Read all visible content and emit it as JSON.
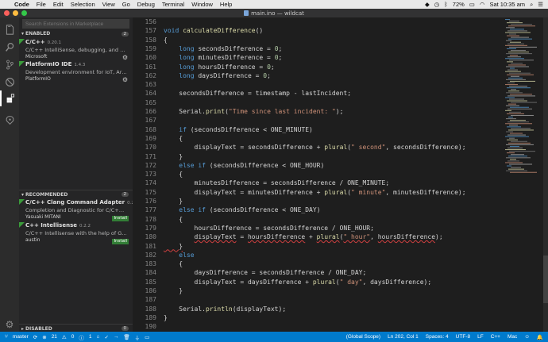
{
  "menubar": {
    "items": [
      "Code",
      "File",
      "Edit",
      "Selection",
      "View",
      "Go",
      "Debug",
      "Terminal",
      "Window",
      "Help"
    ],
    "battery": "72%",
    "clock": "Sat 10:35 am"
  },
  "window": {
    "title": "main.ino — wildcat"
  },
  "sidebar": {
    "search_placeholder": "Search Extensions in Marketplace",
    "enabled": {
      "title": "ENABLED",
      "count": "2",
      "items": [
        {
          "name": "C/C++",
          "version": "0.20.1",
          "description": "C/C++ IntelliSense, debugging, and code ...",
          "publisher": "Microsoft"
        },
        {
          "name": "PlatformIO IDE",
          "version": "1.4.3",
          "description": "Development environment for IoT, Arduino...",
          "publisher": "PlatformIO"
        }
      ]
    },
    "recommended": {
      "title": "RECOMMENDED",
      "count": "2",
      "items": [
        {
          "name": "C/C++ Clang Command Adapter",
          "version": "0.2.3",
          "description": "Completion and Diagnostic for C/C++/Obj...",
          "publisher": "Yasuaki MITANI",
          "action": "Install"
        },
        {
          "name": "C++ Intellisense",
          "version": "0.2.2",
          "description": "C/C++ Intellisense with the help of GNU Gl...",
          "publisher": "austin",
          "action": "Install"
        }
      ]
    },
    "disabled": {
      "title": "DISABLED",
      "count": "0"
    }
  },
  "editor": {
    "line_numbers": [
      "156",
      "157",
      "158",
      "159",
      "160",
      "161",
      "162",
      "163",
      "164",
      "165",
      "166",
      "167",
      "168",
      "169",
      "170",
      "171",
      "172",
      "173",
      "174",
      "175",
      "176",
      "177",
      "178",
      "179",
      "180",
      "181",
      "182",
      "183",
      "184",
      "185",
      "186",
      "187",
      "188",
      "189",
      "190"
    ],
    "lines": [
      [],
      [
        {
          "t": "void ",
          "c": "kw"
        },
        {
          "t": "calculateDifference",
          "c": "fn"
        },
        {
          "t": "()",
          "c": ""
        }
      ],
      [
        {
          "t": "{",
          "c": ""
        }
      ],
      [
        {
          "t": "    long ",
          "c": "kw"
        },
        {
          "t": "secondsDifference = ",
          "c": ""
        },
        {
          "t": "0",
          "c": "num"
        },
        {
          "t": ";",
          "c": ""
        }
      ],
      [
        {
          "t": "    long ",
          "c": "kw"
        },
        {
          "t": "minutesDifference = ",
          "c": ""
        },
        {
          "t": "0",
          "c": "num"
        },
        {
          "t": ";",
          "c": ""
        }
      ],
      [
        {
          "t": "    long ",
          "c": "kw"
        },
        {
          "t": "hoursDifference = ",
          "c": ""
        },
        {
          "t": "0",
          "c": "num"
        },
        {
          "t": ";",
          "c": ""
        }
      ],
      [
        {
          "t": "    long ",
          "c": "kw"
        },
        {
          "t": "daysDifference = ",
          "c": ""
        },
        {
          "t": "0",
          "c": "num"
        },
        {
          "t": ";",
          "c": ""
        }
      ],
      [],
      [
        {
          "t": "    secondsDifference = timestamp - lastIncident;",
          "c": ""
        }
      ],
      [],
      [
        {
          "t": "    Serial.",
          "c": ""
        },
        {
          "t": "print",
          "c": "fn"
        },
        {
          "t": "(",
          "c": ""
        },
        {
          "t": "\"Time since last incident: \"",
          "c": "str"
        },
        {
          "t": ");",
          "c": ""
        }
      ],
      [],
      [
        {
          "t": "    if ",
          "c": "kw"
        },
        {
          "t": "(secondsDifference < ONE_MINUTE)",
          "c": ""
        }
      ],
      [
        {
          "t": "    {",
          "c": ""
        }
      ],
      [
        {
          "t": "        displayText = secondsDifference + ",
          "c": ""
        },
        {
          "t": "plural",
          "c": "fn"
        },
        {
          "t": "(",
          "c": ""
        },
        {
          "t": "\" second\"",
          "c": "str"
        },
        {
          "t": ", secondsDifference);",
          "c": ""
        }
      ],
      [
        {
          "t": "    }",
          "c": ""
        }
      ],
      [
        {
          "t": "    else if ",
          "c": "kw"
        },
        {
          "t": "(secondsDifference < ONE_HOUR)",
          "c": ""
        }
      ],
      [
        {
          "t": "    {",
          "c": ""
        }
      ],
      [
        {
          "t": "        minutesDifference = secondsDifference / ONE_MINUTE;",
          "c": ""
        }
      ],
      [
        {
          "t": "        displayText = minutesDifference + ",
          "c": ""
        },
        {
          "t": "plural",
          "c": "fn"
        },
        {
          "t": "(",
          "c": ""
        },
        {
          "t": "\" minute\"",
          "c": "str"
        },
        {
          "t": ", minutesDifference);",
          "c": ""
        }
      ],
      [
        {
          "t": "    }",
          "c": ""
        }
      ],
      [
        {
          "t": "    else if ",
          "c": "kw"
        },
        {
          "t": "(secondsDifference < ONE_DAY)",
          "c": ""
        }
      ],
      [
        {
          "t": "    {",
          "c": ""
        }
      ],
      [
        {
          "t": "        hoursDifference = secondsDifference / ONE_HOUR;",
          "c": ""
        }
      ],
      [
        {
          "t": "        ",
          "c": ""
        },
        {
          "t": "displayText",
          "c": "sq"
        },
        {
          "t": " = ",
          "c": ""
        },
        {
          "t": "hoursDifference",
          "c": "sq"
        },
        {
          "t": " + ",
          "c": ""
        },
        {
          "t": "plural",
          "c": "fn sq"
        },
        {
          "t": "(",
          "c": ""
        },
        {
          "t": "\" hour\"",
          "c": "str sq"
        },
        {
          "t": ", ",
          "c": ""
        },
        {
          "t": "hoursDifference",
          "c": "sq"
        },
        {
          "t": ");",
          "c": ""
        }
      ],
      [
        {
          "t": "    }",
          "c": "sq"
        }
      ],
      [
        {
          "t": "    else",
          "c": "kw"
        }
      ],
      [
        {
          "t": "    {",
          "c": ""
        }
      ],
      [
        {
          "t": "        daysDifference = secondsDifference / ONE_DAY;",
          "c": ""
        }
      ],
      [
        {
          "t": "        displayText = daysDifference + ",
          "c": ""
        },
        {
          "t": "plural",
          "c": "fn"
        },
        {
          "t": "(",
          "c": ""
        },
        {
          "t": "\" day\"",
          "c": "str"
        },
        {
          "t": ", daysDifference);",
          "c": ""
        }
      ],
      [
        {
          "t": "    }",
          "c": ""
        }
      ],
      [],
      [
        {
          "t": "    Serial.",
          "c": ""
        },
        {
          "t": "println",
          "c": "fn"
        },
        {
          "t": "(displayText);",
          "c": ""
        }
      ],
      [
        {
          "t": "}",
          "c": ""
        }
      ],
      []
    ]
  },
  "statusbar": {
    "branch": "master",
    "errors": "21",
    "warnings": "0",
    "alerts": "1",
    "scope": "(Global Scope)",
    "position": "Ln 202, Col 1",
    "spaces": "Spaces: 4",
    "encoding": "UTF-8",
    "eol": "LF",
    "language": "C++",
    "platform": "Mac"
  },
  "colors": {
    "accent": "#007acc",
    "install": "#327e36",
    "keyword": "#569cd6",
    "function": "#dcdcaa",
    "string": "#ce9178",
    "number": "#b5cea8"
  }
}
